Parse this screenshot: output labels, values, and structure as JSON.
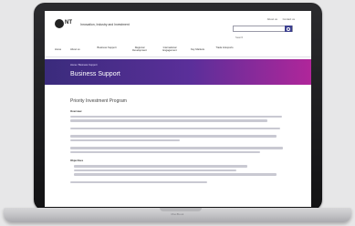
{
  "site": {
    "logo_text": "NT",
    "department": "Innovation, Industry and Investment",
    "utility_links": [
      "About us",
      "Contact us"
    ],
    "search_placeholder": "Search"
  },
  "nav": {
    "items": [
      "Home",
      "About us",
      "Business Support",
      "Regional Development",
      "International Engagement",
      "Key Markets",
      "Trade & Exports"
    ]
  },
  "hero": {
    "breadcrumb": "Home / Business Support",
    "title": "Business Support"
  },
  "content": {
    "heading": "Priority Investment Program",
    "sections": [
      "Overview",
      "Objectives"
    ]
  },
  "device": {
    "brand": "MacBook"
  }
}
